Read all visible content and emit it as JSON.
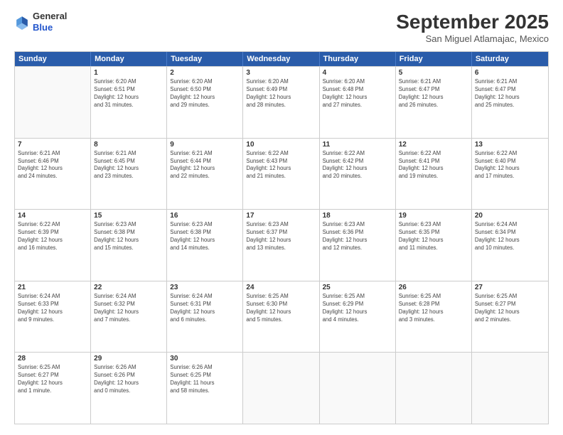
{
  "logo": {
    "general": "General",
    "blue": "Blue"
  },
  "header": {
    "month": "September 2025",
    "location": "San Miguel Atlamajac, Mexico"
  },
  "days": [
    "Sunday",
    "Monday",
    "Tuesday",
    "Wednesday",
    "Thursday",
    "Friday",
    "Saturday"
  ],
  "weeks": [
    [
      {
        "num": "",
        "empty": true
      },
      {
        "num": "1",
        "info": "Sunrise: 6:20 AM\nSunset: 6:51 PM\nDaylight: 12 hours\nand 31 minutes."
      },
      {
        "num": "2",
        "info": "Sunrise: 6:20 AM\nSunset: 6:50 PM\nDaylight: 12 hours\nand 29 minutes."
      },
      {
        "num": "3",
        "info": "Sunrise: 6:20 AM\nSunset: 6:49 PM\nDaylight: 12 hours\nand 28 minutes."
      },
      {
        "num": "4",
        "info": "Sunrise: 6:20 AM\nSunset: 6:48 PM\nDaylight: 12 hours\nand 27 minutes."
      },
      {
        "num": "5",
        "info": "Sunrise: 6:21 AM\nSunset: 6:47 PM\nDaylight: 12 hours\nand 26 minutes."
      },
      {
        "num": "6",
        "info": "Sunrise: 6:21 AM\nSunset: 6:47 PM\nDaylight: 12 hours\nand 25 minutes."
      }
    ],
    [
      {
        "num": "7",
        "info": "Sunrise: 6:21 AM\nSunset: 6:46 PM\nDaylight: 12 hours\nand 24 minutes."
      },
      {
        "num": "8",
        "info": "Sunrise: 6:21 AM\nSunset: 6:45 PM\nDaylight: 12 hours\nand 23 minutes."
      },
      {
        "num": "9",
        "info": "Sunrise: 6:21 AM\nSunset: 6:44 PM\nDaylight: 12 hours\nand 22 minutes."
      },
      {
        "num": "10",
        "info": "Sunrise: 6:22 AM\nSunset: 6:43 PM\nDaylight: 12 hours\nand 21 minutes."
      },
      {
        "num": "11",
        "info": "Sunrise: 6:22 AM\nSunset: 6:42 PM\nDaylight: 12 hours\nand 20 minutes."
      },
      {
        "num": "12",
        "info": "Sunrise: 6:22 AM\nSunset: 6:41 PM\nDaylight: 12 hours\nand 19 minutes."
      },
      {
        "num": "13",
        "info": "Sunrise: 6:22 AM\nSunset: 6:40 PM\nDaylight: 12 hours\nand 17 minutes."
      }
    ],
    [
      {
        "num": "14",
        "info": "Sunrise: 6:22 AM\nSunset: 6:39 PM\nDaylight: 12 hours\nand 16 minutes."
      },
      {
        "num": "15",
        "info": "Sunrise: 6:23 AM\nSunset: 6:38 PM\nDaylight: 12 hours\nand 15 minutes."
      },
      {
        "num": "16",
        "info": "Sunrise: 6:23 AM\nSunset: 6:38 PM\nDaylight: 12 hours\nand 14 minutes."
      },
      {
        "num": "17",
        "info": "Sunrise: 6:23 AM\nSunset: 6:37 PM\nDaylight: 12 hours\nand 13 minutes."
      },
      {
        "num": "18",
        "info": "Sunrise: 6:23 AM\nSunset: 6:36 PM\nDaylight: 12 hours\nand 12 minutes."
      },
      {
        "num": "19",
        "info": "Sunrise: 6:23 AM\nSunset: 6:35 PM\nDaylight: 12 hours\nand 11 minutes."
      },
      {
        "num": "20",
        "info": "Sunrise: 6:24 AM\nSunset: 6:34 PM\nDaylight: 12 hours\nand 10 minutes."
      }
    ],
    [
      {
        "num": "21",
        "info": "Sunrise: 6:24 AM\nSunset: 6:33 PM\nDaylight: 12 hours\nand 9 minutes."
      },
      {
        "num": "22",
        "info": "Sunrise: 6:24 AM\nSunset: 6:32 PM\nDaylight: 12 hours\nand 7 minutes."
      },
      {
        "num": "23",
        "info": "Sunrise: 6:24 AM\nSunset: 6:31 PM\nDaylight: 12 hours\nand 6 minutes."
      },
      {
        "num": "24",
        "info": "Sunrise: 6:25 AM\nSunset: 6:30 PM\nDaylight: 12 hours\nand 5 minutes."
      },
      {
        "num": "25",
        "info": "Sunrise: 6:25 AM\nSunset: 6:29 PM\nDaylight: 12 hours\nand 4 minutes."
      },
      {
        "num": "26",
        "info": "Sunrise: 6:25 AM\nSunset: 6:28 PM\nDaylight: 12 hours\nand 3 minutes."
      },
      {
        "num": "27",
        "info": "Sunrise: 6:25 AM\nSunset: 6:27 PM\nDaylight: 12 hours\nand 2 minutes."
      }
    ],
    [
      {
        "num": "28",
        "info": "Sunrise: 6:25 AM\nSunset: 6:27 PM\nDaylight: 12 hours\nand 1 minute."
      },
      {
        "num": "29",
        "info": "Sunrise: 6:26 AM\nSunset: 6:26 PM\nDaylight: 12 hours\nand 0 minutes."
      },
      {
        "num": "30",
        "info": "Sunrise: 6:26 AM\nSunset: 6:25 PM\nDaylight: 11 hours\nand 58 minutes."
      },
      {
        "num": "",
        "empty": true
      },
      {
        "num": "",
        "empty": true
      },
      {
        "num": "",
        "empty": true
      },
      {
        "num": "",
        "empty": true
      }
    ]
  ]
}
